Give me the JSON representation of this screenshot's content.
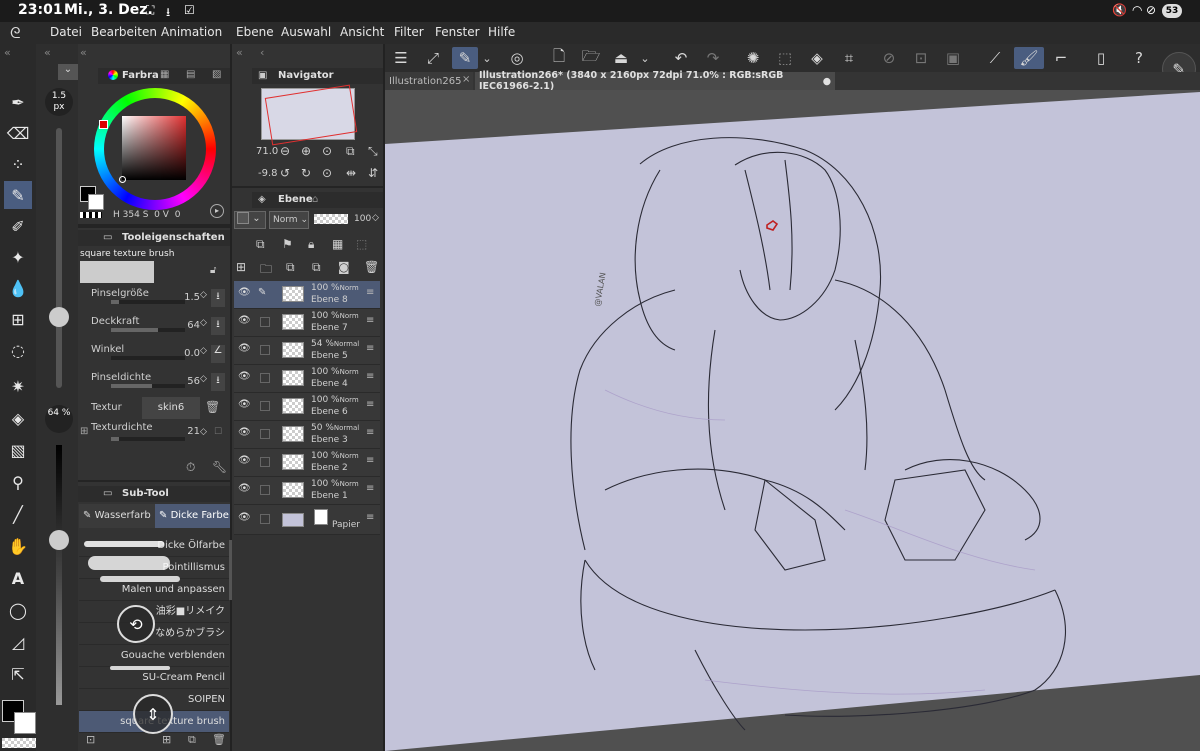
{
  "status": {
    "time": "23:01",
    "date": "Mi., 3. Dez.",
    "battery": "53"
  },
  "menu": [
    "Datei",
    "Bearbeiten",
    "Animation",
    "Ebene",
    "Auswahl",
    "Ansicht",
    "Filter",
    "Fenster",
    "Hilfe"
  ],
  "tabs": {
    "tab1": "Illustration265",
    "tab2": "Illustration266* (3840 x 2160px 72dpi 71.0% : RGB:sRGB IEC61966-2.1)"
  },
  "brush_size_bubble": "1.5 px",
  "opacity_bubble": "64 %",
  "color_panel": {
    "title": "Farbra",
    "h": "354",
    "s": "0",
    "v": "0",
    "h_label": "H",
    "s_label": "S",
    "v_label": "V"
  },
  "tool_props": {
    "title": "Tooleigenschaften",
    "brush_name": "square texture brush",
    "rows": [
      {
        "label": "Pinselgröße",
        "value": "1.5"
      },
      {
        "label": "Deckkraft",
        "value": "64"
      },
      {
        "label": "Winkel",
        "value": "0.0"
      },
      {
        "label": "Pinseldichte",
        "value": "56"
      }
    ],
    "texture_label": "Textur",
    "texture_value": "skin6",
    "texture_density_label": "Texturdichte",
    "texture_density_value": "21"
  },
  "subtool": {
    "title": "Sub-Tool",
    "tab1": "Wasserfarb",
    "tab2": "Dicke Farbe",
    "items": [
      "Dicke Ölfarbe",
      "Pointillismus",
      "Malen und anpassen",
      "油彩■リメイク",
      "なめらかブラシ",
      "Gouache verblenden",
      "SU-Cream Pencil",
      "SOIPEN",
      "square texture brush"
    ]
  },
  "navigator": {
    "title": "Navigator",
    "zoom": "71.0",
    "angle": "-9.8"
  },
  "layers": {
    "title": "Ebene",
    "blend": "Norm",
    "opacity": "100",
    "items": [
      {
        "op": "100 %",
        "mode": "Norm",
        "name": "Ebene 8",
        "selected": true
      },
      {
        "op": "100 %",
        "mode": "Norm",
        "name": "Ebene 7"
      },
      {
        "op": "54 %",
        "mode": "Normal",
        "name": "Ebene 5"
      },
      {
        "op": "100 %",
        "mode": "Norm",
        "name": "Ebene 4"
      },
      {
        "op": "100 %",
        "mode": "Norm",
        "name": "Ebene 6"
      },
      {
        "op": "50 %",
        "mode": "Normal",
        "name": "Ebene 3"
      },
      {
        "op": "100 %",
        "mode": "Norm",
        "name": "Ebene 2"
      },
      {
        "op": "100 %",
        "mode": "Norm",
        "name": "Ebene 1"
      }
    ],
    "paper": "Papier"
  },
  "watermark": "@VALAN",
  "colors": {
    "accent": "#4a5d80",
    "canvas": "#c3c3d9",
    "panel": "#333333"
  }
}
